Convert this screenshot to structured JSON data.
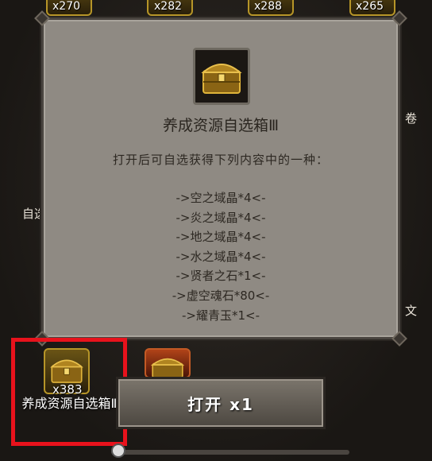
{
  "top_counts": [
    "x270",
    "x282",
    "x288",
    "x265"
  ],
  "side_labels": {
    "left_mid": "自选",
    "right_top": "卷",
    "right_bottom": "文"
  },
  "popup": {
    "title": "养成资源自选箱Ⅲ",
    "description": "打开后可自选获得下列内容中的一种：",
    "options": [
      "->空之域晶*4<-",
      "->炎之域晶*4<-",
      "->地之域晶*4<-",
      "->水之域晶*4<-",
      "->贤者之石*1<-",
      "->虚空魂石*80<-",
      "->耀青玉*1<-"
    ]
  },
  "selected_item": {
    "count": "x383",
    "name": "养成资源自选箱Ⅲ"
  },
  "open_button": {
    "label": "打开 x1"
  },
  "colors": {
    "highlight": "#e8121c",
    "popup_bg": "#8f8a83",
    "gold": "#b69528"
  }
}
